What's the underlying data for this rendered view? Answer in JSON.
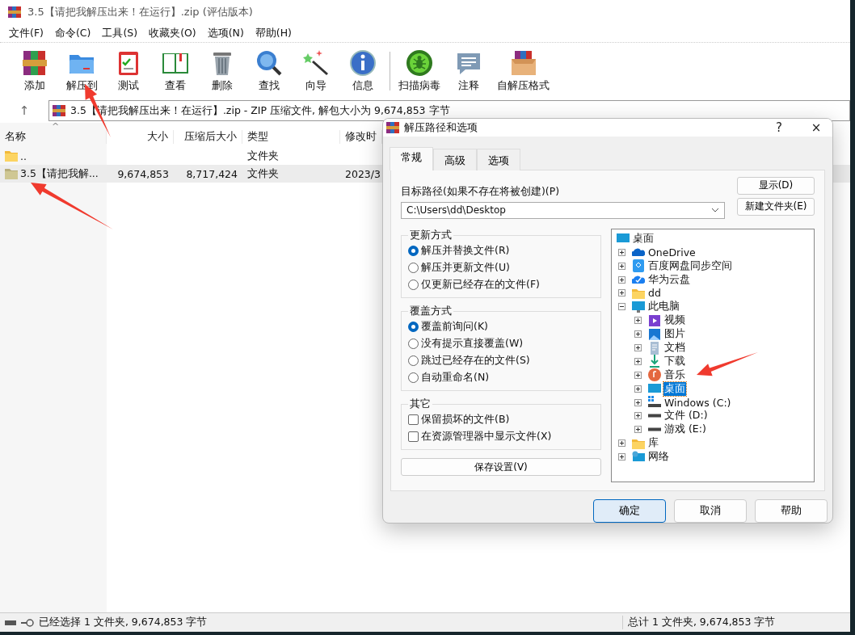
{
  "window": {
    "title": "3.5【请把我解压出来！在运行】.zip (评估版本)"
  },
  "menu": [
    "文件(F)",
    "命令(C)",
    "工具(S)",
    "收藏夹(O)",
    "选项(N)",
    "帮助(H)"
  ],
  "toolbar": [
    {
      "label": "添加",
      "kind": "books"
    },
    {
      "label": "解压到",
      "kind": "folder"
    },
    {
      "label": "测试",
      "kind": "clipboard"
    },
    {
      "label": "查看",
      "kind": "book"
    },
    {
      "label": "删除",
      "kind": "trash"
    },
    {
      "label": "查找",
      "kind": "magnifier"
    },
    {
      "label": "向导",
      "kind": "wand"
    },
    {
      "label": "信息",
      "kind": "info"
    },
    {
      "label": "扫描病毒",
      "kind": "virus",
      "separator_before": true
    },
    {
      "label": "注释",
      "kind": "comment"
    },
    {
      "label": "自解压格式",
      "kind": "box"
    }
  ],
  "address": {
    "up": "↑",
    "path": "3.5【请把我解压出来！在运行】.zip - ZIP 压缩文件, 解包大小为 9,674,853 字节"
  },
  "table": {
    "columns": [
      "名称",
      "大小",
      "压缩后大小",
      "类型",
      "修改时"
    ],
    "sort_mark": "^",
    "rows": [
      {
        "cells": [
          "..",
          "",
          "",
          "文件夹",
          ""
        ],
        "selected": false
      },
      {
        "cells": [
          "3.5【请把我解...",
          "9,674,853",
          "8,717,424",
          "文件夹",
          "2023/3"
        ],
        "selected": true
      }
    ]
  },
  "status_bar": {
    "left": "已经选择 1 文件夹, 9,674,853 字节",
    "right": "总计 1 文件夹, 9,674,853 字节"
  },
  "dialog": {
    "title": "解压路径和选项",
    "help": "?",
    "close": "×",
    "tabs": [
      {
        "label": "常规",
        "selected": true
      },
      {
        "label": "高级",
        "selected": false
      },
      {
        "label": "选项",
        "selected": false
      }
    ],
    "path_label": "目标路径(如果不存在将被创建)(P)",
    "path_value": "C:\\Users\\dd\\Desktop",
    "side_buttons": [
      "显示(D)",
      "新建文件夹(E)"
    ],
    "groups": [
      {
        "title": "更新方式",
        "kind": "radio",
        "options": [
          {
            "label": "解压并替换文件(R)",
            "selected": true
          },
          {
            "label": "解压并更新文件(U)",
            "selected": false
          },
          {
            "label": "仅更新已经存在的文件(F)",
            "selected": false
          }
        ]
      },
      {
        "title": "覆盖方式",
        "kind": "radio",
        "options": [
          {
            "label": "覆盖前询问(K)",
            "selected": true
          },
          {
            "label": "没有提示直接覆盖(W)",
            "selected": false
          },
          {
            "label": "跳过已经存在的文件(S)",
            "selected": false
          },
          {
            "label": "自动重命名(N)",
            "selected": false
          }
        ]
      },
      {
        "title": "其它",
        "kind": "check",
        "options": [
          {
            "label": "保留损坏的文件(B)",
            "checked": false
          },
          {
            "label": "在资源管理器中显示文件(X)",
            "checked": false
          }
        ]
      }
    ],
    "save_button": "保存设置(V)",
    "tree": {
      "label": "桌面",
      "kind": "desktop",
      "children": [
        {
          "label": "OneDrive",
          "kind": "cloud",
          "expanded": false,
          "selected": false
        },
        {
          "label": "百度网盘同步空间",
          "kind": "netdisk",
          "expanded": false,
          "selected": false
        },
        {
          "label": "华为云盘",
          "kind": "cloudcheck",
          "expanded": false,
          "selected": false
        },
        {
          "label": "dd",
          "kind": "folder",
          "expanded": false,
          "selected": false
        },
        {
          "label": "此电脑",
          "kind": "monitor",
          "expanded": true,
          "selected": false,
          "children": [
            {
              "label": "视频",
              "kind": "video",
              "expanded": false,
              "selected": false
            },
            {
              "label": "图片",
              "kind": "picture",
              "expanded": false,
              "selected": false
            },
            {
              "label": "文档",
              "kind": "document",
              "expanded": false,
              "selected": false
            },
            {
              "label": "下载",
              "kind": "download",
              "expanded": false,
              "selected": false
            },
            {
              "label": "音乐",
              "kind": "music",
              "expanded": false,
              "selected": false
            },
            {
              "label": "桌面",
              "kind": "desktop",
              "expanded": false,
              "selected": true
            },
            {
              "label": "Windows (C:)",
              "kind": "windrive",
              "expanded": false,
              "selected": false
            },
            {
              "label": "文件 (D:)",
              "kind": "drive",
              "expanded": false,
              "selected": false
            },
            {
              "label": "游戏 (E:)",
              "kind": "drive",
              "expanded": false,
              "selected": false
            }
          ]
        },
        {
          "label": "库",
          "kind": "library",
          "expanded": false,
          "selected": false
        },
        {
          "label": "网络",
          "kind": "network",
          "expanded": false,
          "selected": false
        }
      ]
    },
    "buttons": [
      {
        "label": "确定",
        "default": true
      },
      {
        "label": "取消",
        "default": false
      },
      {
        "label": "帮助",
        "default": false
      }
    ]
  }
}
